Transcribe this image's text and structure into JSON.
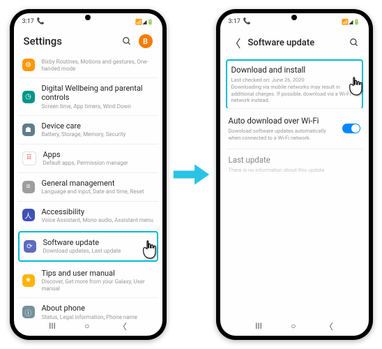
{
  "status": {
    "time": "3:17",
    "icons": "🔊 ⚙ 📶 📶 ⚡ 🔋"
  },
  "left": {
    "title": "Settings",
    "avatar": "B",
    "items": [
      {
        "label": "Bixby Routines, Motions and gestures, One-handed mode",
        "sub": "",
        "icon": "#ff9800",
        "glyph": "⚙"
      },
      {
        "label": "Digital Wellbeing and parental controls",
        "sub": "Screen time, App timers, Wind Down",
        "icon": "#009688",
        "glyph": "◷"
      },
      {
        "label": "Device care",
        "sub": "Battery, Storage, Memory, Security",
        "icon": "#607d8b",
        "glyph": "☗"
      },
      {
        "label": "Apps",
        "sub": "Default apps, Permission manager",
        "icon": "#f2f2f2",
        "glyph": "⠿"
      },
      {
        "label": "General management",
        "sub": "Language and input, Date and time, Reset",
        "icon": "#9e9e9e",
        "glyph": "≡"
      },
      {
        "label": "Accessibility",
        "sub": "Voice Assistant, Mono audio, Assistant menu",
        "icon": "#3f51b5",
        "glyph": "⊕"
      },
      {
        "label": "Software update",
        "sub": "Download updates, Last update",
        "icon": "#5c6bc0",
        "glyph": "⟳"
      },
      {
        "label": "Tips and user manual",
        "sub": "Discover, Get more from your Galaxy, User manual",
        "icon": "#ffb300",
        "glyph": "★"
      },
      {
        "label": "About phone",
        "sub": "Status, Legal information, Phone name",
        "icon": "#78909c",
        "glyph": "ⓘ"
      }
    ]
  },
  "right": {
    "title": "Software update",
    "download": {
      "title": "Download and install",
      "sub": "Last checked on: June 26, 2020\nDownloading via mobile networks may result in additional charges. If possible, download via a Wi-Fi network instead."
    },
    "auto": {
      "title": "Auto download over Wi-Fi",
      "sub": "Download software updates automatically when connected to a Wi-Fi network."
    },
    "last": {
      "title": "Last update",
      "sub": "There is no information about this update"
    }
  }
}
